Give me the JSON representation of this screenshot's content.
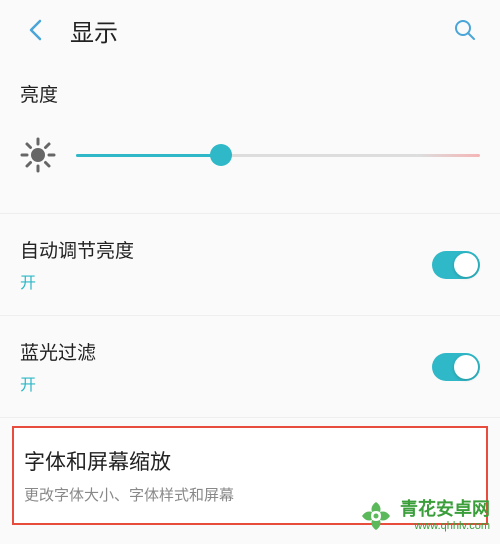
{
  "header": {
    "title": "显示"
  },
  "brightness": {
    "label": "亮度",
    "slider_percent": 36
  },
  "settings": {
    "auto_brightness": {
      "label": "自动调节亮度",
      "status": "开",
      "enabled": true
    },
    "blue_light": {
      "label": "蓝光过滤",
      "status": "开",
      "enabled": true
    },
    "font_zoom": {
      "label": "字体和屏幕缩放",
      "desc": "更改字体大小、字体样式和屏幕"
    }
  },
  "watermark": {
    "title": "青花安卓网",
    "url": "www.qhhlv.com"
  },
  "colors": {
    "accent": "#2fb8c7",
    "highlight_border": "#e74c3c",
    "brand": "#3a9e3a"
  }
}
